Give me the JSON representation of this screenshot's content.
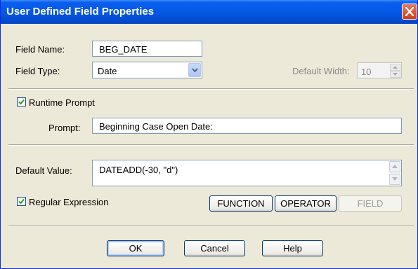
{
  "window": {
    "title": "User Defined Field Properties"
  },
  "field_name": {
    "label": "Field Name:",
    "value": "BEG_DATE"
  },
  "field_type": {
    "label": "Field Type:",
    "value": "Date"
  },
  "default_width": {
    "label": "Default Width:",
    "value": "10"
  },
  "runtime_prompt": {
    "label": "Runtime Prompt",
    "checked": true
  },
  "prompt": {
    "label": "Prompt:",
    "value": "Beginning Case Open Date:"
  },
  "default_value": {
    "label": "Default Value:",
    "value": "DATEADD(-30, \"d\")"
  },
  "regular_expression": {
    "label": "Regular Expression",
    "checked": true
  },
  "buttons": {
    "function": "FUNCTION",
    "operator": "OPERATOR",
    "field": "FIELD",
    "ok": "OK",
    "cancel": "Cancel",
    "help": "Help"
  },
  "icons": {
    "close": "close-icon",
    "dropdown": "chevron-down-icon",
    "spin_up": "spin-up-icon",
    "spin_down": "spin-down-icon",
    "check": "checkmark-icon",
    "scroll_up": "scroll-up-icon",
    "scroll_down": "scroll-down-icon"
  },
  "colors": {
    "title_bar": "#0457e3",
    "dialog_bg": "#ece9d8",
    "close_button": "#d43c18",
    "input_border": "#7f9db9"
  }
}
